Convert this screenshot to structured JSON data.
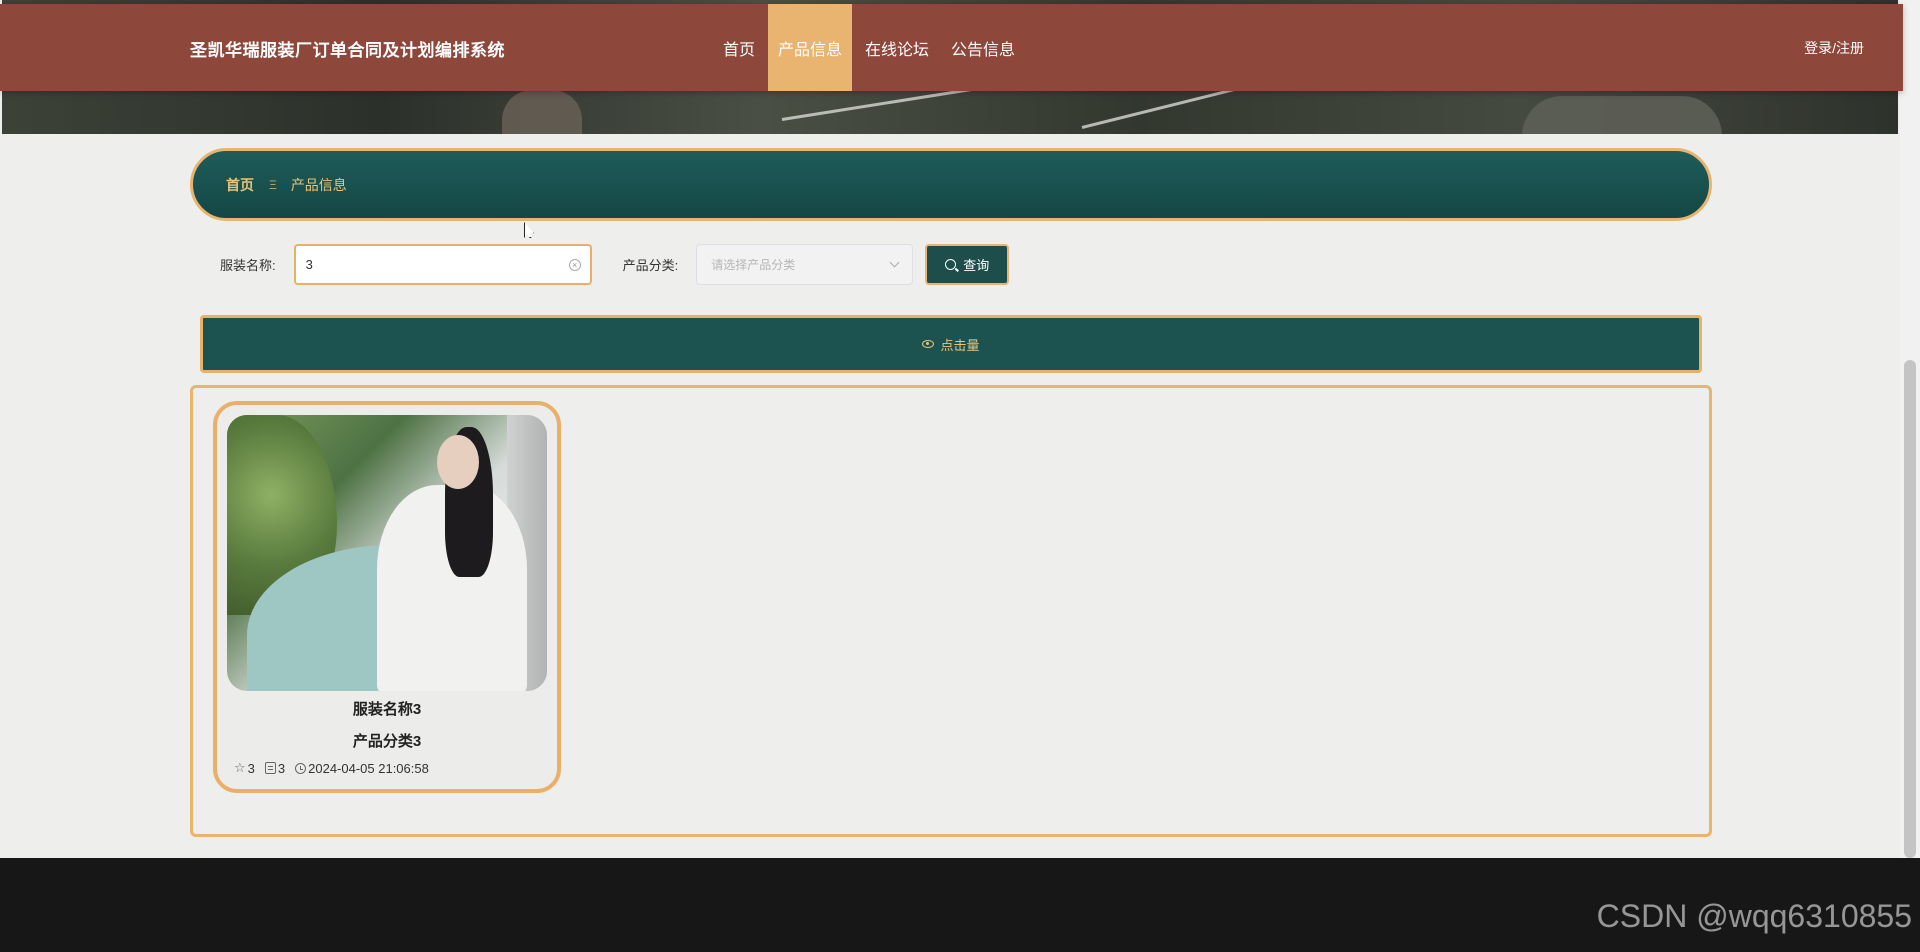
{
  "header": {
    "site_title": "圣凯华瑞服装厂订单合同及计划编排系统",
    "nav": [
      {
        "label": "首页",
        "active": false
      },
      {
        "label": "产品信息",
        "active": true
      },
      {
        "label": "在线论坛",
        "active": false
      },
      {
        "label": "公告信息",
        "active": false
      }
    ],
    "login_label": "登录/注册"
  },
  "breadcrumb": {
    "home": "首页",
    "separator": "Ξ",
    "current": "产品信息"
  },
  "search": {
    "name_label": "服装名称:",
    "name_value": "3",
    "category_label": "产品分类:",
    "category_placeholder": "请选择产品分类",
    "query_button": "查询"
  },
  "sort": {
    "label": "点击量"
  },
  "products": [
    {
      "name": "服装名称3",
      "category": "产品分类3",
      "favorites": "3",
      "views": "3",
      "time": "2024-04-05 21:06:58"
    }
  ],
  "watermark": "CSDN @wqq6310855",
  "colors": {
    "header_bg": "#8e473b",
    "accent": "#e9b46d",
    "teal": "#1c5351"
  }
}
